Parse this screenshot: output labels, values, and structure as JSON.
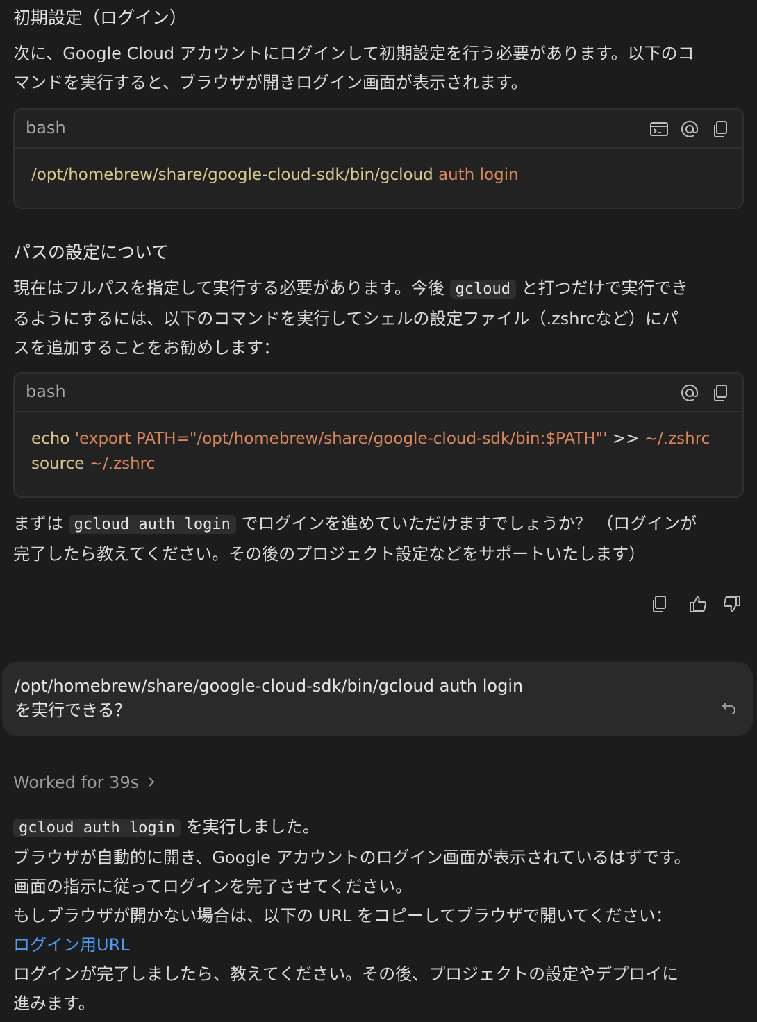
{
  "section1": {
    "heading": "初期設定（ログイン）",
    "para_line1": "次に、Google Cloud アカウントにログインして初期設定を行う必要があります。以下のコ",
    "para_line2": "マンドを実行すると、ブラウザが開きログイン画面が表示されます。"
  },
  "codeblock1": {
    "lang": "bash",
    "path": "/opt/homebrew/share/google-cloud-sdk/bin/gcloud",
    "args": " auth login"
  },
  "section2": {
    "heading": "パスの設定について",
    "line1_a": "現在はフルパスを指定して実行する必要があります。今後 ",
    "line1_code": "gcloud",
    "line1_b": " と打つだけで実行でき",
    "line2": "るようにするには、以下のコマンドを実行してシェルの設定ファイル（.zshrcなど）にパ",
    "line3": "スを追加することをお勧めします："
  },
  "codeblock2": {
    "lang": "bash",
    "l1_cmd": "echo",
    "l1_str": " 'export PATH=\"/opt/homebrew/share/google-cloud-sdk/bin:$PATH\"'",
    "l1_op": " >> ",
    "l1_file": "~/.zshrc",
    "l2_cmd": "source",
    "l2_file": " ~/.zshrc"
  },
  "section3": {
    "line1_a": "まずは ",
    "line1_code": "gcloud auth login",
    "line1_b": " でログインを進めていただけますでしょうか？ （ログインが",
    "line2": "完了したら教えてください。その後のプロジェクト設定などをサポートいたします）"
  },
  "user_message": {
    "line1": "/opt/homebrew/share/google-cloud-sdk/bin/gcloud auth login",
    "line2": "を実行できる？"
  },
  "worked": {
    "label": "Worked for 39s"
  },
  "answer": {
    "line1_code": "gcloud auth login",
    "line1_b": " を実行しました。",
    "line2": "ブラウザが自動的に開き、Google アカウントのログイン画面が表示されているはずです。",
    "line3": "画面の指示に従ってログインを完了させてください。",
    "line4": "もしブラウザが開かない場合は、以下の URL をコピーしてブラウザで開いてください：",
    "link": "ログイン用URL",
    "line5": "ログインが完了しましたら、教えてください。その後、プロジェクトの設定やデプロイに",
    "line6": "進みます。"
  },
  "icons": [
    "terminal-icon",
    "mention-icon",
    "copy-icon",
    "thumbs-up-icon",
    "thumbs-down-icon",
    "undo-icon",
    "chevron-right-icon"
  ]
}
